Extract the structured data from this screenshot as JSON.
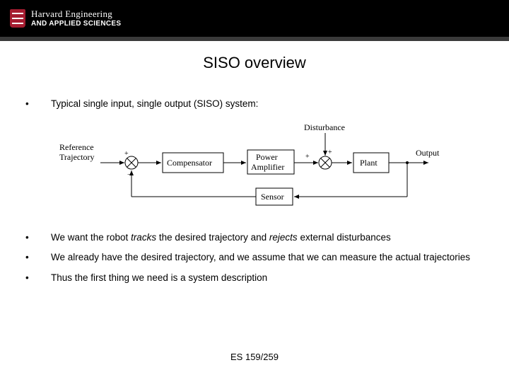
{
  "header": {
    "logo_line1": "Harvard Engineering",
    "logo_line2": "AND APPLIED SCIENCES"
  },
  "title": "SISO overview",
  "bullets": [
    {
      "text": "Typical single input, single output (SISO) system:"
    },
    {
      "html": "We want the robot <span class='em-it'>tracks</span> the desired trajectory and <span class='em-it'>rejects</span> external disturbances"
    },
    {
      "text": "We already have the desired trajectory, and we assume that we can measure the actual trajectories"
    },
    {
      "text": "Thus the first thing we need is a system description"
    }
  ],
  "diagram": {
    "ref_line1": "Reference",
    "ref_line2": "Trajectory",
    "compensator": "Compensator",
    "power_line1": "Power",
    "power_line2": "Amplifier",
    "plant": "Plant",
    "output": "Output",
    "sensor": "Sensor",
    "disturbance": "Disturbance",
    "plus": "+",
    "minus": "−"
  },
  "footer": "ES 159/259"
}
